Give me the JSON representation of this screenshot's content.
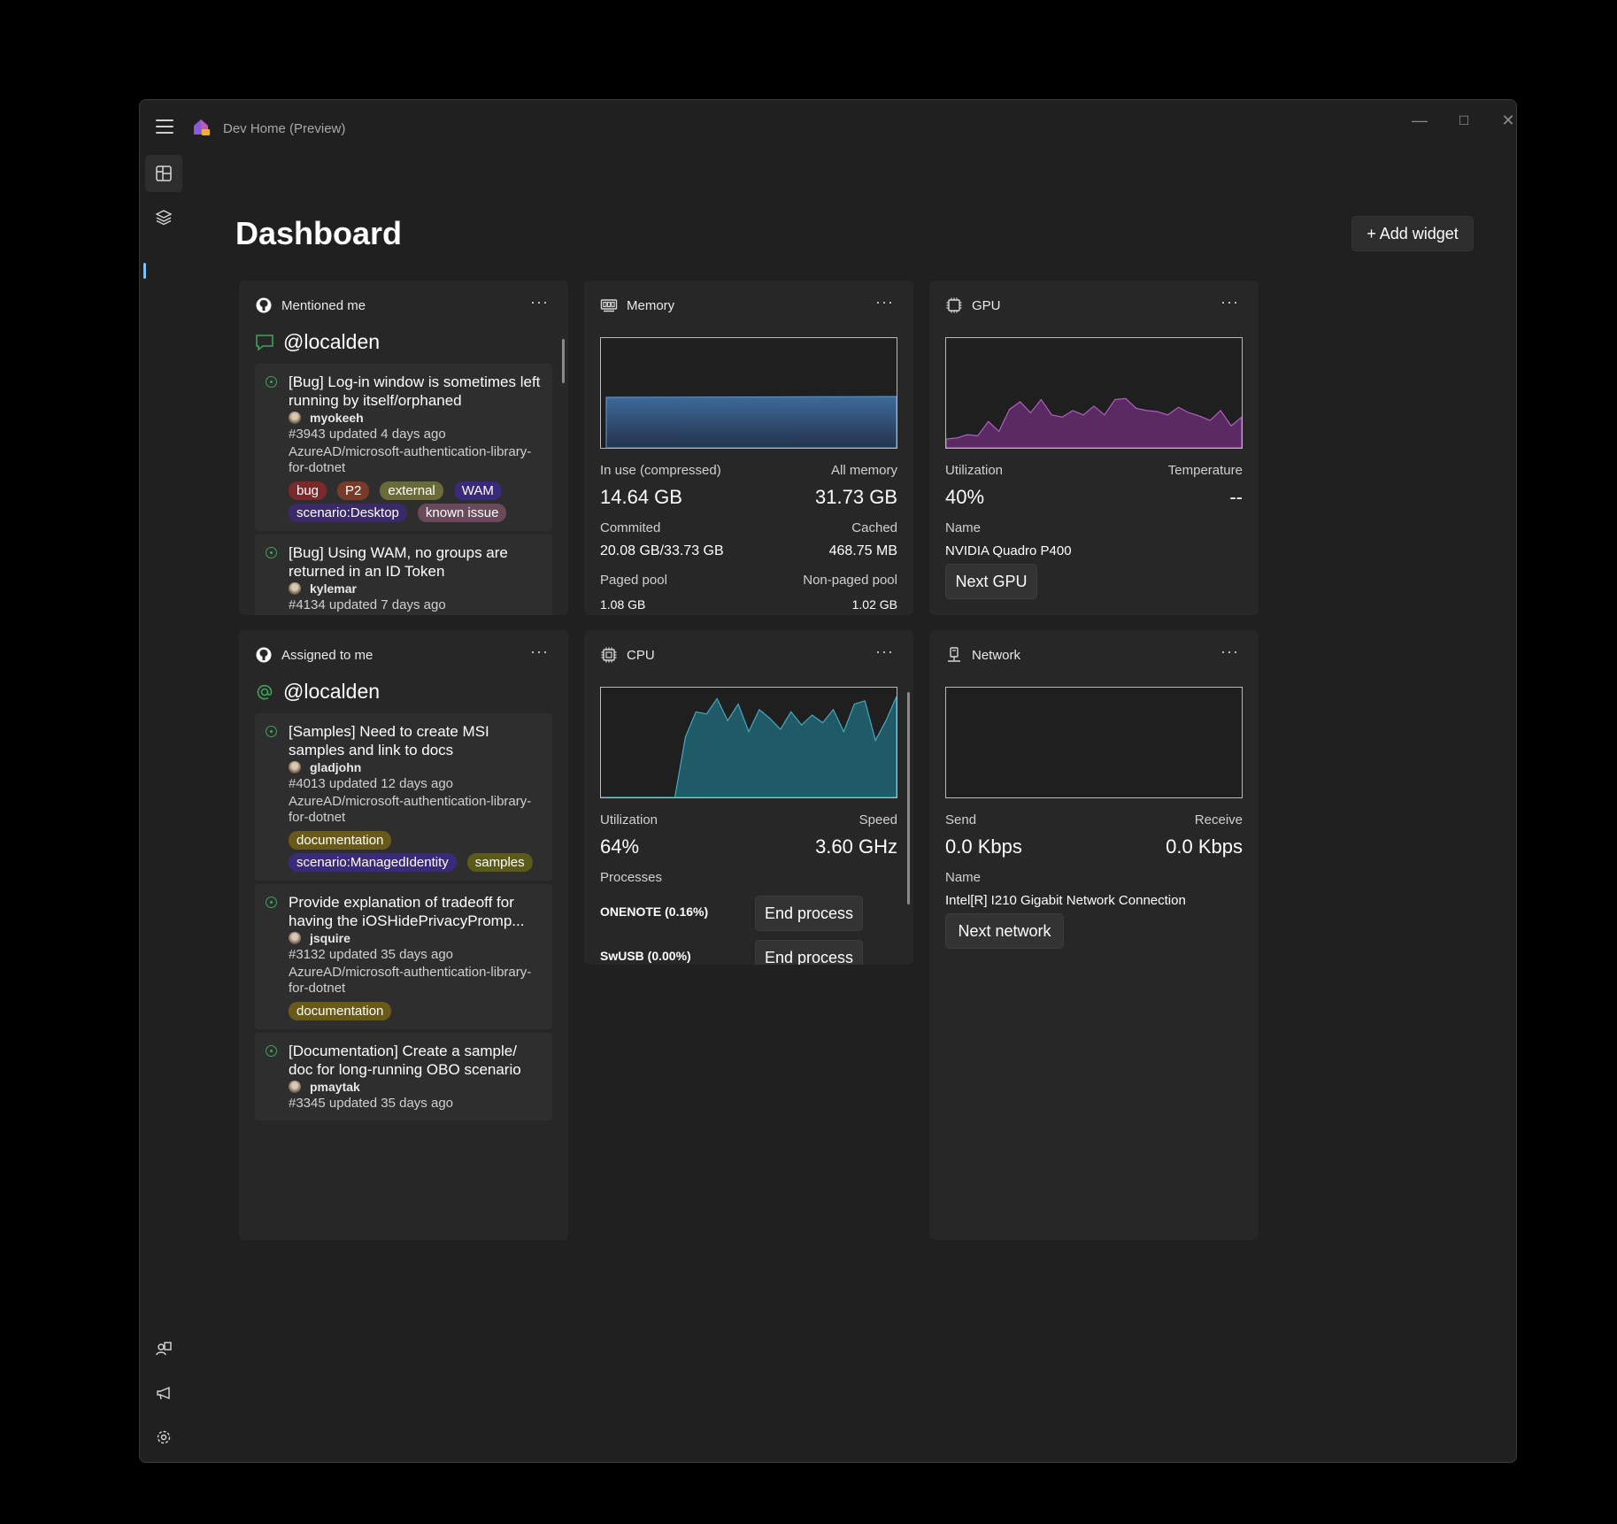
{
  "app": {
    "title": "Dev Home (Preview)",
    "window_controls": {
      "minimize": "—",
      "maximize": "☐",
      "close": "✕"
    }
  },
  "page": {
    "title": "Dashboard",
    "add_widget_label": "+ Add widget"
  },
  "widgets": {
    "mentioned": {
      "title": "Mentioned me",
      "more": "···",
      "user": "@localden",
      "issues": [
        {
          "title": "[Bug] Log-in window is sometimes left running by itself/orphaned",
          "author": "myokeeh",
          "meta": "#3943 updated 4 days ago",
          "repo": "AzureAD/microsoft-authentication-library-for-dotnet",
          "labels": [
            {
              "text": "bug",
              "color": "#7a2a2a"
            },
            {
              "text": "P2",
              "color": "#7a3a2a"
            },
            {
              "text": "external",
              "color": "#6a6a3a"
            },
            {
              "text": "WAM",
              "color": "#3a2a7a"
            },
            {
              "text": "scenario:Desktop",
              "color": "#3a2a6a"
            },
            {
              "text": "known issue",
              "color": "#6a4a5a"
            }
          ]
        },
        {
          "title": "[Bug] Using WAM, no groups are returned in an ID Token",
          "author": "kylemar",
          "meta": "#4134 updated 7 days ago"
        }
      ]
    },
    "assigned": {
      "title": "Assigned to me",
      "more": "···",
      "user": "@localden",
      "issues": [
        {
          "title": "[Samples] Need to create MSI samples and link to docs",
          "author": "gladjohn",
          "meta": "#4013 updated 12 days ago",
          "repo": "AzureAD/microsoft-authentication-library-for-dotnet",
          "labels": [
            {
              "text": "documentation",
              "color": "#6a5a1a"
            },
            {
              "text": "scenario:ManagedIdentity",
              "color": "#3a2a7a"
            },
            {
              "text": "samples",
              "color": "#5a5a1a"
            }
          ]
        },
        {
          "title": "Provide explanation of tradeoff for having the iOSHidePrivacyPromp...",
          "author": "jsquire",
          "meta": "#3132 updated 35 days ago",
          "repo": "AzureAD/microsoft-authentication-library-for-dotnet",
          "labels": [
            {
              "text": "documentation",
              "color": "#6a5a1a"
            }
          ]
        },
        {
          "title": "[Documentation] Create a sample/ doc for long-running OBO scenario",
          "author": "pmaytak",
          "meta": "#3345 updated 35 days ago"
        }
      ]
    },
    "memory": {
      "title": "Memory",
      "more": "···",
      "in_use_label": "In use (compressed)",
      "in_use_value": "14.64 GB",
      "all_label": "All memory",
      "all_value": "31.73 GB",
      "committed_label": "Commited",
      "committed_value": "20.08 GB/33.73 GB",
      "cached_label": "Cached",
      "cached_value": "468.75 MB",
      "paged_label": "Paged pool",
      "paged_value": "1.08 GB",
      "nonpaged_label": "Non-paged pool",
      "nonpaged_value": "1.02 GB",
      "usage_fraction": 0.46,
      "color": "#3d6a9a"
    },
    "gpu": {
      "title": "GPU",
      "more": "···",
      "util_label": "Utilization",
      "util_value": "40%",
      "temp_label": "Temperature",
      "temp_value": "--",
      "name_label": "Name",
      "name_value": "NVIDIA Quadro P400",
      "next_label": "Next GPU",
      "history": [
        8,
        9,
        12,
        11,
        24,
        15,
        35,
        42,
        32,
        44,
        30,
        28,
        34,
        30,
        38,
        30,
        44,
        45,
        36,
        34,
        33,
        30,
        37,
        32,
        29,
        25,
        34,
        20,
        28
      ],
      "color": "#a04aa8"
    },
    "cpu": {
      "title": "CPU",
      "more": "···",
      "util_label": "Utilization",
      "util_value": "64%",
      "speed_label": "Speed",
      "speed_value": "3.60 GHz",
      "processes_label": "Processes",
      "processes": [
        {
          "name": "ONENOTE (0.16%)",
          "button": "End process"
        },
        {
          "name": "SwUSB (0.00%)",
          "button": "End process"
        }
      ],
      "history": [
        0,
        0,
        0,
        0,
        0,
        0,
        0,
        0,
        55,
        78,
        76,
        90,
        70,
        85,
        60,
        80,
        72,
        62,
        78,
        66,
        75,
        68,
        80,
        60,
        85,
        88,
        52,
        70,
        92
      ],
      "color": "#2f7a8a"
    },
    "network": {
      "title": "Network",
      "more": "···",
      "send_label": "Send",
      "send_value": "0.0 Kbps",
      "receive_label": "Receive",
      "receive_value": "0.0 Kbps",
      "name_label": "Name",
      "name_value": "Intel[R] I210 Gigabit Network Connection",
      "next_label": "Next network"
    }
  }
}
